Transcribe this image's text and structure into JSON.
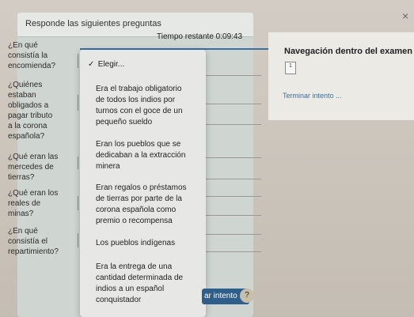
{
  "heading": "Responde las siguientes preguntas",
  "timer": "Tiempo restante 0:09:43",
  "questions": [
    {
      "lines": [
        "¿En qué",
        "consistía la",
        "encomienda?"
      ]
    },
    {
      "lines": [
        "¿Quiénes",
        "estaban",
        "obligados a",
        "pagar tributo",
        "a la corona",
        "española?"
      ]
    },
    {
      "lines": [
        "¿Qué eran las",
        "mercedes de",
        "tierras?"
      ]
    },
    {
      "lines": [
        "¿Qué eran los",
        "reales de",
        "minas?"
      ]
    },
    {
      "lines": [
        "¿En qué",
        "consistía el",
        "repartimiento?"
      ]
    }
  ],
  "dropdown": {
    "selected": "Elegir...",
    "options": [
      {
        "lines": [
          "Era el trabajo obligatorio",
          "de todos los indios por",
          "turnos con el goce de un",
          "pequeño sueldo"
        ]
      },
      {
        "lines": [
          "Eran los pueblos que se",
          "dedicaban a la extracción",
          "minera"
        ]
      },
      {
        "lines": [
          "Eran regalos o préstamos",
          "de tierras por parte de la",
          "corona española como",
          "premio o recompensa"
        ]
      },
      {
        "lines": [
          "Los pueblos indígenas"
        ]
      },
      {
        "lines": [
          "Era la entrega de una",
          "cantidad determinada de",
          "indios a un español",
          "conquistador"
        ]
      }
    ]
  },
  "navigation": {
    "title": "Navegación dentro del examen",
    "question_number": "1",
    "finish_link": "Terminar intento ..."
  },
  "finish_button": "ar intento",
  "help_icon": "?",
  "close_icon": "×"
}
